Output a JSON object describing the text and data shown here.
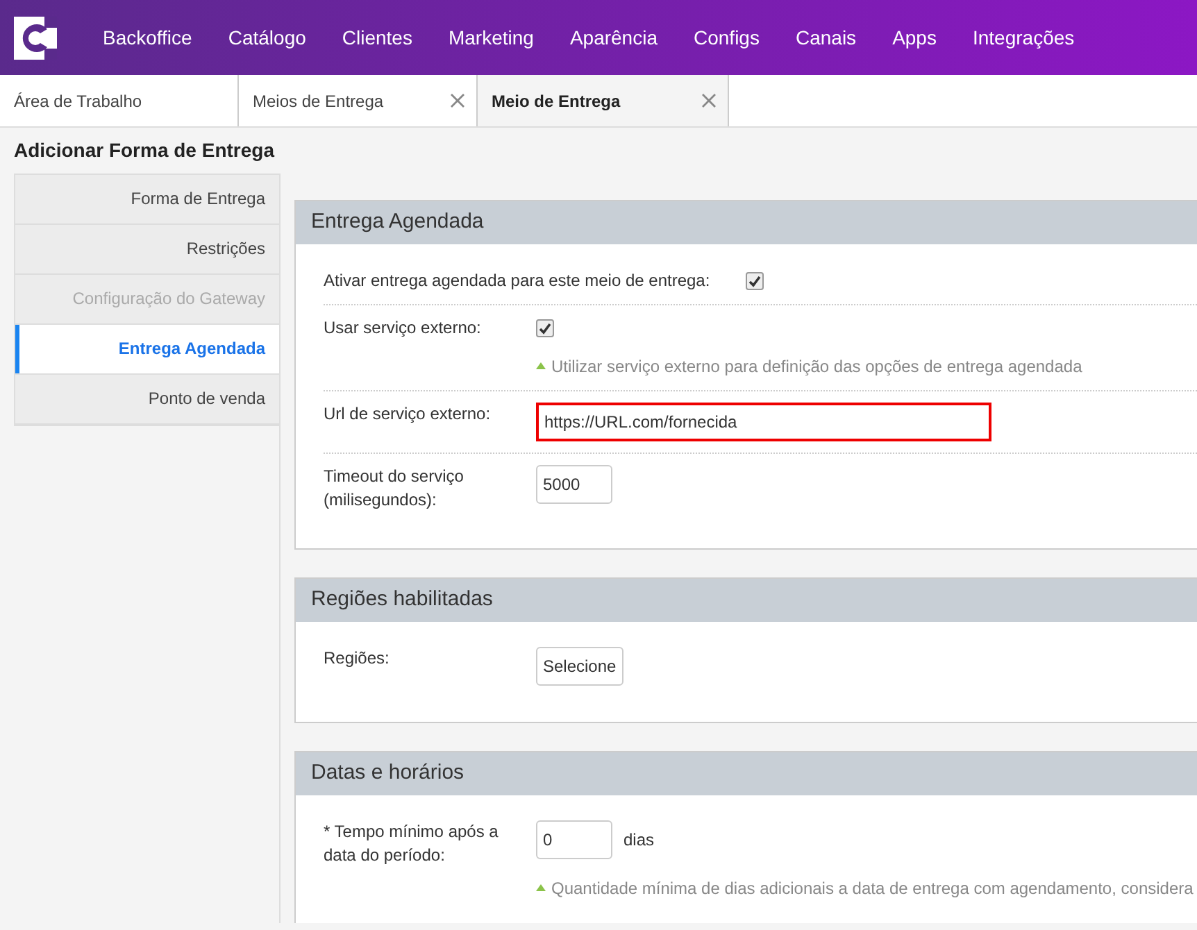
{
  "nav": {
    "items": [
      "Backoffice",
      "Catálogo",
      "Clientes",
      "Marketing",
      "Aparência",
      "Configs",
      "Canais",
      "Apps",
      "Integrações"
    ]
  },
  "tabs": [
    {
      "label": "Área de Trabalho",
      "selected": false,
      "closable": false
    },
    {
      "label": "Meios de Entrega",
      "selected": false,
      "closable": true
    },
    {
      "label": "Meio de Entrega",
      "selected": true,
      "closable": true
    }
  ],
  "page_title": "Adicionar Forma de Entrega",
  "sidebar": {
    "items": [
      {
        "label": "Forma de Entrega",
        "selected": false,
        "disabled": false
      },
      {
        "label": "Restrições",
        "selected": false,
        "disabled": false
      },
      {
        "label": "Configuração do Gateway",
        "selected": false,
        "disabled": true
      },
      {
        "label": "Entrega Agendada",
        "selected": true,
        "disabled": false
      },
      {
        "label": "Ponto de venda",
        "selected": false,
        "disabled": false
      }
    ]
  },
  "sections": [
    {
      "title": "Entrega Agendada",
      "fields": [
        {
          "kind": "checkbox",
          "label": "Ativar entrega agendada para este meio de entrega:",
          "checked": true,
          "inline": true
        },
        {
          "kind": "checkbox",
          "label": "Usar serviço externo:",
          "checked": true,
          "hint": "Utilizar serviço externo para definição das opções de entrega agendada"
        },
        {
          "kind": "text",
          "label": "Url de serviço externo:",
          "value": "https://URL.com/fornecida",
          "highlighted": true
        },
        {
          "kind": "number",
          "label": "Timeout do serviço (milisegundos):",
          "value": "5000"
        }
      ]
    },
    {
      "title": "Regiões habilitadas",
      "fields": [
        {
          "kind": "select",
          "label": "Regiões:",
          "button": "Selecione"
        }
      ]
    },
    {
      "title": "Datas e horários",
      "fields": [
        {
          "kind": "number",
          "label": "* Tempo mínimo após a data do período:",
          "value": "0",
          "unit": "dias",
          "hint": "Quantidade mínima de dias adicionais a data de entrega com agendamento, considera"
        }
      ]
    }
  ]
}
